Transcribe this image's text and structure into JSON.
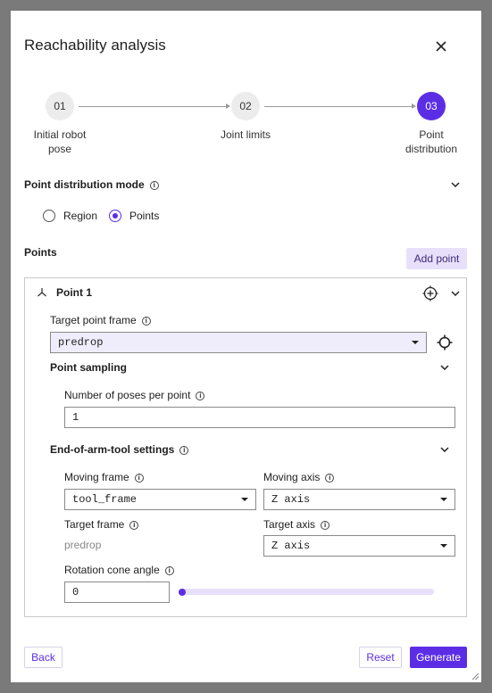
{
  "dialog": {
    "title": "Reachability analysis",
    "close_icon": "close-icon"
  },
  "stepper": {
    "steps": [
      {
        "number": "01",
        "label_line1": "Initial robot",
        "label_line2": "pose",
        "state": "done"
      },
      {
        "number": "02",
        "label_line1": "Joint limits",
        "label_line2": "",
        "state": "done"
      },
      {
        "number": "03",
        "label_line1": "Point",
        "label_line2": "distribution",
        "state": "active"
      }
    ]
  },
  "distribution_mode": {
    "title": "Point distribution mode",
    "options": [
      {
        "label": "Region",
        "selected": false
      },
      {
        "label": "Points",
        "selected": true
      }
    ]
  },
  "points": {
    "title": "Points",
    "add_button": "Add point",
    "point": {
      "name": "Point 1",
      "icon": "axes-icon",
      "target_frame_label": "Target point frame",
      "target_frame_value": "predrop",
      "sampling": {
        "title": "Point sampling",
        "poses_label": "Number of poses per point",
        "poses_value": "1"
      },
      "eoat": {
        "title": "End-of-arm-tool settings",
        "moving_frame_label": "Moving frame",
        "moving_frame_value": "tool_frame",
        "moving_axis_label": "Moving axis",
        "moving_axis_value": "Z axis",
        "target_frame_label": "Target frame",
        "target_frame_value": "predrop",
        "target_axis_label": "Target axis",
        "target_axis_value": "Z axis",
        "rotation_label": "Rotation cone angle",
        "rotation_value": "0",
        "rotation_fraction": 0
      }
    }
  },
  "footer": {
    "back": "Back",
    "reset": "Reset",
    "generate": "Generate"
  },
  "colors": {
    "accent": "#5b2ee6",
    "accent_soft": "#e8e0fb",
    "overlay": "#7a7a7a"
  }
}
